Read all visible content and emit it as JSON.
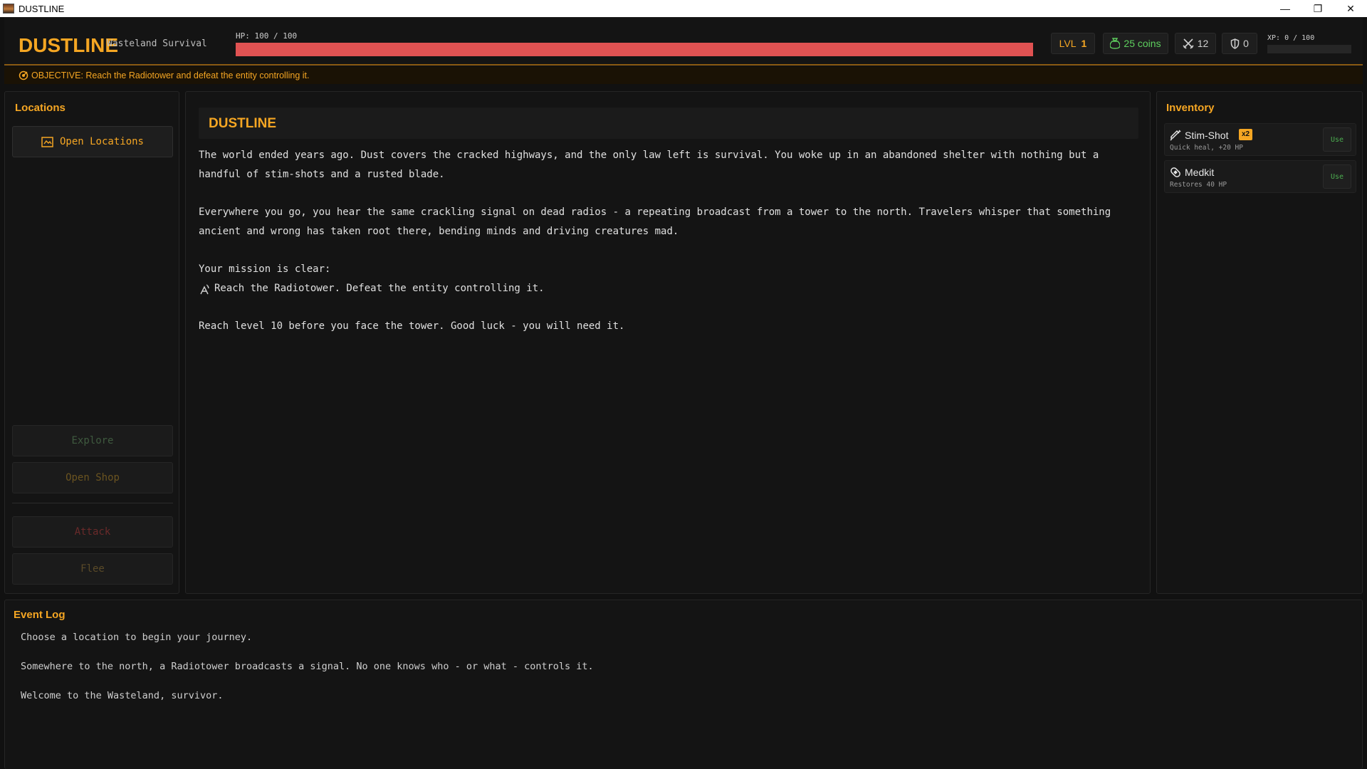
{
  "window": {
    "title": "DUSTLINE",
    "minimize": "—",
    "restore": "❐",
    "close": "✕"
  },
  "header": {
    "brand": "DUSTLINE",
    "tagline": "Wasteland Survival",
    "hp_label": "HP: 100 / 100",
    "hp_fraction": 1.0,
    "level_label": "LVL",
    "level_value": "1",
    "coins": "25 coins",
    "attack": "12",
    "defense": "0",
    "xp_label": "XP: 0 / 100",
    "xp_fraction": 0.0
  },
  "objective": {
    "text": "OBJECTIVE: Reach the Radiotower and defeat the entity controlling it."
  },
  "left_panel": {
    "title": "Locations",
    "open_locations": "Open Locations",
    "explore": "Explore",
    "open_shop": "Open Shop",
    "attack": "Attack",
    "flee": "Flee"
  },
  "story": {
    "title": "DUSTLINE",
    "p1": "The world ended years ago. Dust covers the cracked highways, and the only law left is survival. You woke up in an abandoned shelter with nothing but a handful of stim-shots and a rusted blade.",
    "p2": "Everywhere you go, you hear the same crackling signal on dead radios - a repeating broadcast from a tower to the north. Travelers whisper that something ancient and wrong has taken root there, bending minds and driving creatures mad.",
    "mission_head": "Your mission is clear:",
    "mission_line": "Reach the Radiotower. Defeat the entity controlling it.",
    "p3": "Reach level 10 before you face the tower. Good luck - you will need it."
  },
  "inventory": {
    "title": "Inventory",
    "items": [
      {
        "name": "Stim-Shot",
        "qty": "x2",
        "desc": "Quick heal, +20 HP",
        "use": "Use",
        "icon": "syringe-icon"
      },
      {
        "name": "Medkit",
        "desc": "Restores 40 HP",
        "use": "Use",
        "icon": "bandage-icon"
      }
    ]
  },
  "event_log": {
    "title": "Event Log",
    "lines": [
      "Choose a location to begin your journey.",
      "Somewhere to the north, a Radiotower broadcasts a signal. No one knows who - or what - controls it.",
      "Welcome to the Wasteland, survivor."
    ]
  },
  "colors": {
    "accent": "#f5a623",
    "hp": "#e05252",
    "coins": "#5ecf5e",
    "use": "#4caf50"
  }
}
